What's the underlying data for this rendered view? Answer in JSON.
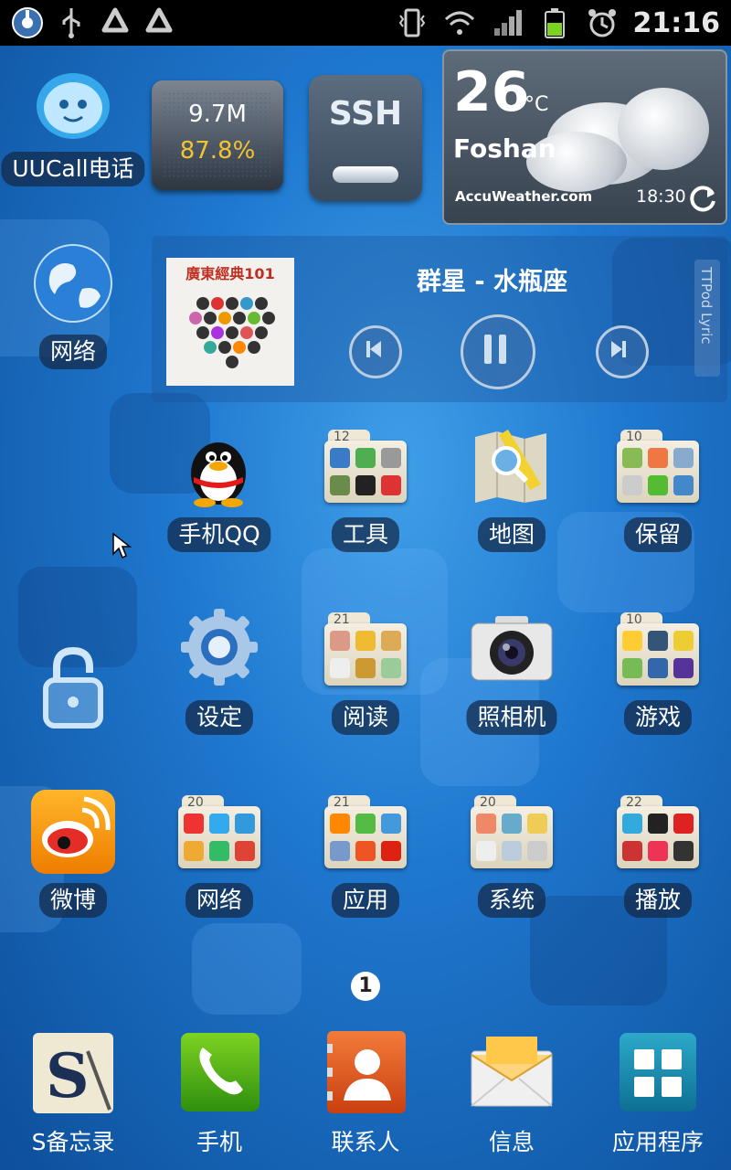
{
  "status_bar": {
    "time": "21:16",
    "left_icons": [
      "notification-app-icon",
      "usb-icon",
      "recycle-icon",
      "recycle-icon"
    ],
    "right_icons": [
      "vibrate-icon",
      "wifi-icon",
      "signal-icon",
      "battery-icon",
      "alarm-icon"
    ]
  },
  "widgets": {
    "uucall_label": "UUCall电话",
    "speed": {
      "traffic": "9.7M",
      "percent": "87.8%"
    },
    "ssh": {
      "label": "SSH"
    },
    "weather": {
      "temp": "26",
      "unit": "°C",
      "city": "Foshan",
      "brand": "AccuWeather.com",
      "time": "18:30"
    },
    "network_label": "网络",
    "music": {
      "song": "群星 - 水瓶座",
      "album_title": "廣東經典101",
      "lyric_tab": "TTPod Lyric"
    }
  },
  "apps_row1": [
    {
      "label": "手机QQ"
    },
    {
      "label": "工具",
      "count": "12"
    },
    {
      "label": "地图"
    },
    {
      "label": "保留",
      "count": "10"
    }
  ],
  "apps_row2": [
    {
      "label": "设定"
    },
    {
      "label": "阅读",
      "count": "21"
    },
    {
      "label": "照相机"
    },
    {
      "label": "游戏",
      "count": "10"
    }
  ],
  "apps_row3": [
    {
      "label": "微博"
    },
    {
      "label": "网络",
      "count": "20"
    },
    {
      "label": "应用",
      "count": "21"
    },
    {
      "label": "系统",
      "count": "20"
    },
    {
      "label": "播放",
      "count": "22"
    }
  ],
  "page_indicator": "1",
  "dock": [
    {
      "label": "S备忘录"
    },
    {
      "label": "手机"
    },
    {
      "label": "联系人"
    },
    {
      "label": "信息"
    },
    {
      "label": "应用程序"
    }
  ],
  "colors": {
    "wallpaper": "#1f78cf",
    "label_bg": "#142846",
    "speed_yellow": "#f4c430"
  }
}
